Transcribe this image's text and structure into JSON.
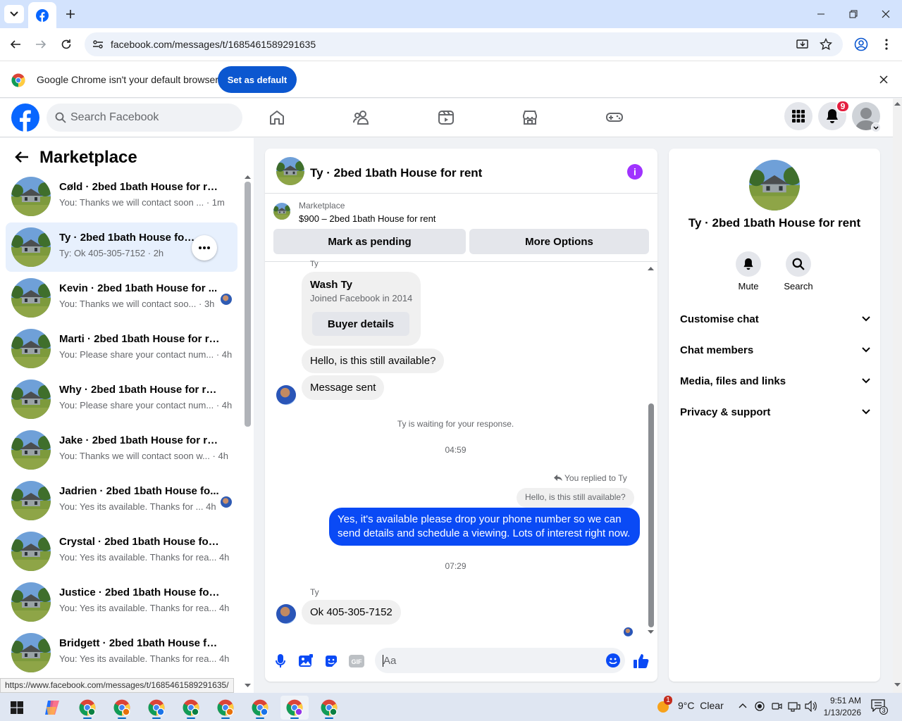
{
  "browser": {
    "url": "facebook.com/messages/t/1685461589291635",
    "infobar_text": "Google Chrome isn't your default browser",
    "set_default_label": "Set as default",
    "status_url": "https://www.facebook.com/messages/t/1685461589291635/"
  },
  "fb": {
    "search_placeholder": "Search Facebook",
    "notification_count": "9"
  },
  "sidebar": {
    "title": "Marketplace",
    "conversations": [
      {
        "title": "Cøld · 2bed 1bath House for rent",
        "preview": "You: Thanks we will contact soon ...",
        "time": "· 1m",
        "avatar": false
      },
      {
        "title": "Ty · 2bed 1bath House for rent",
        "preview": "Ty: Ok 405-305-7152",
        "time": "· 2h",
        "avatar": false
      },
      {
        "title": "Kevin · 2bed 1bath House for ...",
        "preview": "You: Thanks we will contact soo...",
        "time": "· 3h",
        "avatar": true
      },
      {
        "title": "Marti · 2bed 1bath House for rent",
        "preview": "You: Please share your contact num...",
        "time": "· 4h",
        "avatar": false
      },
      {
        "title": "Why · 2bed 1bath House for rent",
        "preview": "You: Please share your contact num...",
        "time": "· 4h",
        "avatar": false
      },
      {
        "title": "Jake · 2bed 1bath House for rent",
        "preview": "You: Thanks we will contact soon w...",
        "time": "· 4h",
        "avatar": false
      },
      {
        "title": "Jadrien · 2bed 1bath House fo...",
        "preview": "You: Yes its available. Thanks for ...",
        "time": "4h",
        "avatar": true
      },
      {
        "title": "Crystal · 2bed 1bath House for r...",
        "preview": "You: Yes its available. Thanks for rea...",
        "time": "4h",
        "avatar": false
      },
      {
        "title": "Justice · 2bed 1bath House for r...",
        "preview": "You: Yes its available. Thanks for rea...",
        "time": "4h",
        "avatar": false
      },
      {
        "title": "Bridgett · 2bed 1bath House for ...",
        "preview": "You: Yes its available. Thanks for rea...",
        "time": "4h",
        "avatar": false
      }
    ]
  },
  "chat": {
    "title": "Ty · 2bed 1bath House for rent",
    "marketplace_label": "Marketplace",
    "listing": "$900 – 2bed 1bath House for rent",
    "mark_pending_label": "Mark as pending",
    "more_options_label": "More Options",
    "top_sender": "Ty",
    "profile_name": "Wash Ty",
    "profile_joined": "Joined Facebook in 2014",
    "buyer_details_label": "Buyer details",
    "msg_available": "Hello, is this still available?",
    "msg_sent": "Message sent",
    "waiting_text": "Ty is waiting for your response.",
    "time_1": "04:59",
    "replied_to": "You replied to Ty",
    "quoted": "Hello, is this still available?",
    "my_reply": "Yes, it's available please drop your phone number so we can send details and schedule a viewing. Lots of interest right now.",
    "time_2": "07:29",
    "sender_name": "Ty",
    "last_msg": "Ok 405-305-7152",
    "composer_placeholder": "Aa"
  },
  "details": {
    "name": "Ty · 2bed 1bath House for rent",
    "mute_label": "Mute",
    "search_label": "Search",
    "sections": [
      "Customise chat",
      "Chat members",
      "Media, files and links",
      "Privacy & support"
    ]
  },
  "taskbar": {
    "temperature": "9°C",
    "weather": "Clear",
    "weather_alert": "1",
    "time": "9:51 AM",
    "date": "1/13/2026",
    "notifications": "3"
  }
}
